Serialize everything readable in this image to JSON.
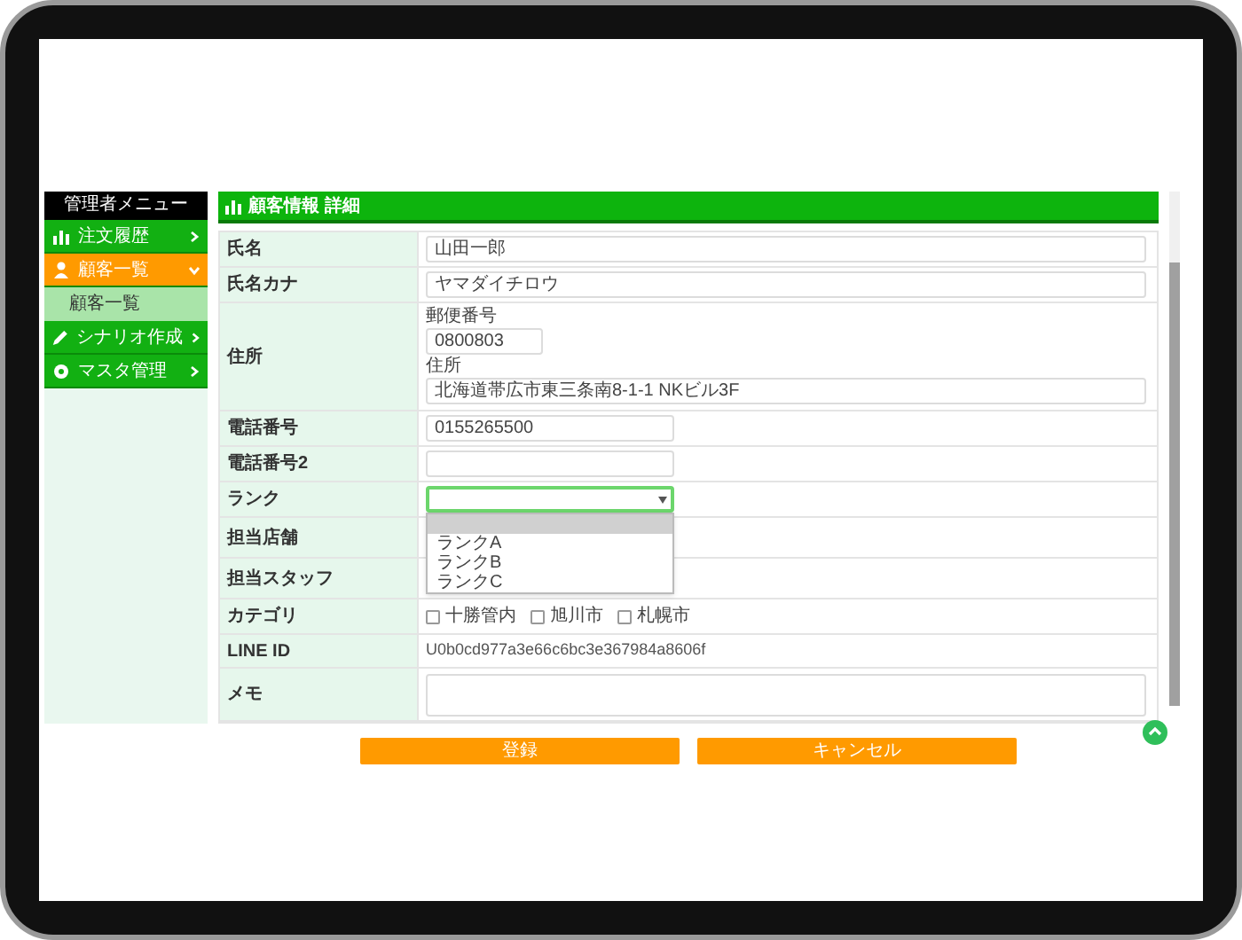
{
  "sidebar": {
    "title": "管理者メニュー",
    "items": [
      {
        "label": "注文履歴",
        "kind": "chart",
        "selected": false,
        "expanded": false
      },
      {
        "label": "顧客一覧",
        "kind": "person",
        "selected": true,
        "expanded": true,
        "children": [
          {
            "label": "顧客一覧",
            "selected": true
          }
        ]
      },
      {
        "label": "シナリオ作成",
        "kind": "pencil",
        "selected": false,
        "expanded": false
      },
      {
        "label": "マスタ管理",
        "kind": "gear",
        "selected": false,
        "expanded": false
      }
    ]
  },
  "form": {
    "title": "顧客情報 詳細",
    "rows": [
      {
        "label": "氏名",
        "kind": "long_text",
        "value": "山田一郎"
      },
      {
        "label": "氏名カナ",
        "kind": "long_text",
        "value": "ヤマダイチロウ"
      },
      {
        "label": "住所",
        "kind": "address",
        "fields": [
          {
            "label": "郵便番号",
            "value": "0800803",
            "kind": "short_text"
          },
          {
            "label": "住所",
            "value": "北海道帯広市東三条南8-1-1 NKビル3F",
            "kind": "long_text"
          }
        ]
      },
      {
        "label": "電話番号",
        "kind": "text",
        "value": "0155265500"
      },
      {
        "label": "電話番号2",
        "kind": "text"
      },
      {
        "label": "ランク",
        "kind": "select",
        "open": true,
        "options": [
          {
            "selected": true
          },
          {
            "label": "ランクA",
            "selected": false
          },
          {
            "label": "ランクB",
            "selected": false
          },
          {
            "label": "ランクC",
            "selected": false
          }
        ]
      },
      {
        "label": "担当店舗",
        "kind": "blank"
      },
      {
        "label": "担当スタッフ",
        "kind": "blank"
      },
      {
        "label": "カテゴリ",
        "kind": "checkboxes",
        "options": [
          {
            "label": "十勝管内",
            "checked": false
          },
          {
            "label": "旭川市",
            "checked": false
          },
          {
            "label": "札幌市",
            "checked": false
          }
        ]
      },
      {
        "label": "LINE ID",
        "kind": "static",
        "value": "U0b0cd977a3e66c6bc3e367984a8606f"
      },
      {
        "label": "メモ",
        "kind": "textarea"
      }
    ]
  },
  "buttons": [
    {
      "label": "登録"
    },
    {
      "label": "キャンセル"
    }
  ]
}
